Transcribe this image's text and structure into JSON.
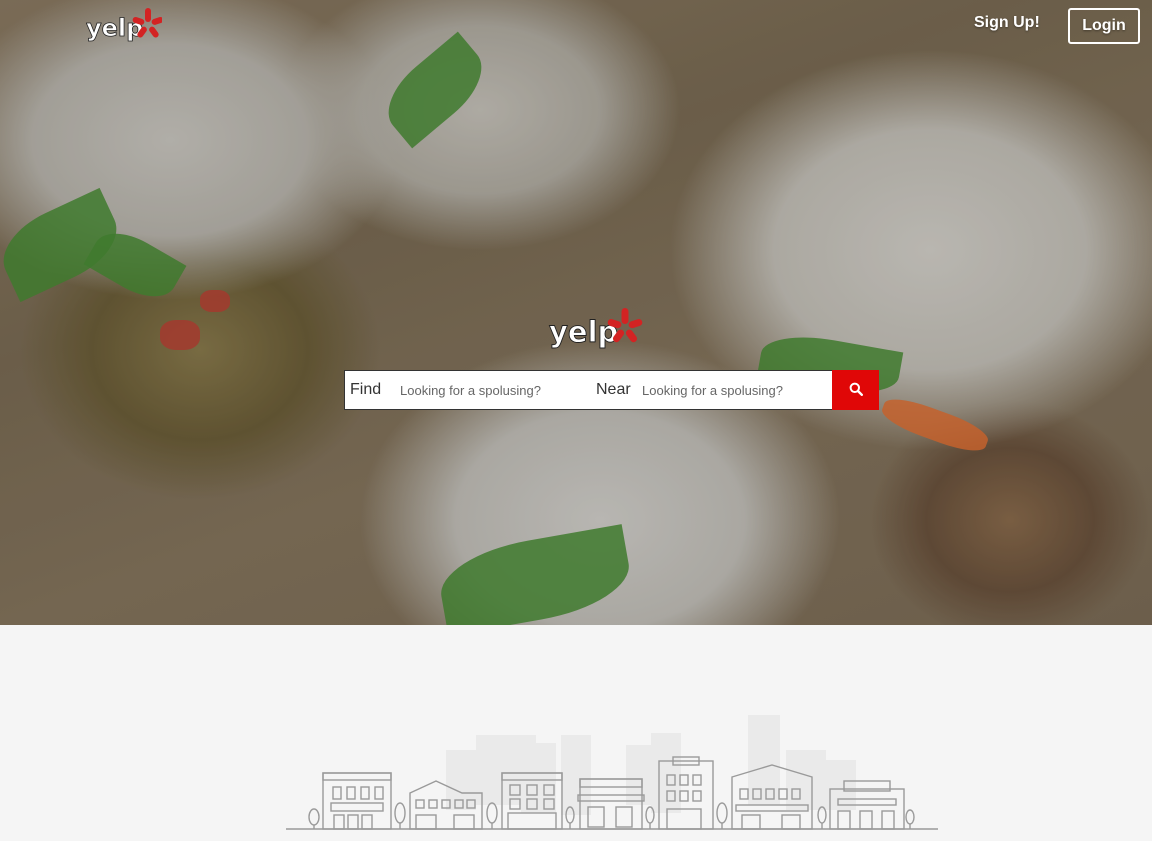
{
  "brand": {
    "name": "yelp"
  },
  "nav": {
    "signup_label": "Sign Up!",
    "login_label": "Login"
  },
  "search": {
    "find_label": "Find",
    "find_placeholder": "Looking for a spolusing?",
    "near_label": "Near",
    "near_placeholder": "Looking for a spolusing?",
    "button_icon": "search-icon"
  },
  "colors": {
    "brand_red": "#e00707",
    "footer_bg": "#f5f5f5",
    "city_line": "#9a9a9a"
  },
  "hero": {
    "image": "food-buns-photo"
  },
  "illustration": {
    "image": "city-skyline"
  }
}
